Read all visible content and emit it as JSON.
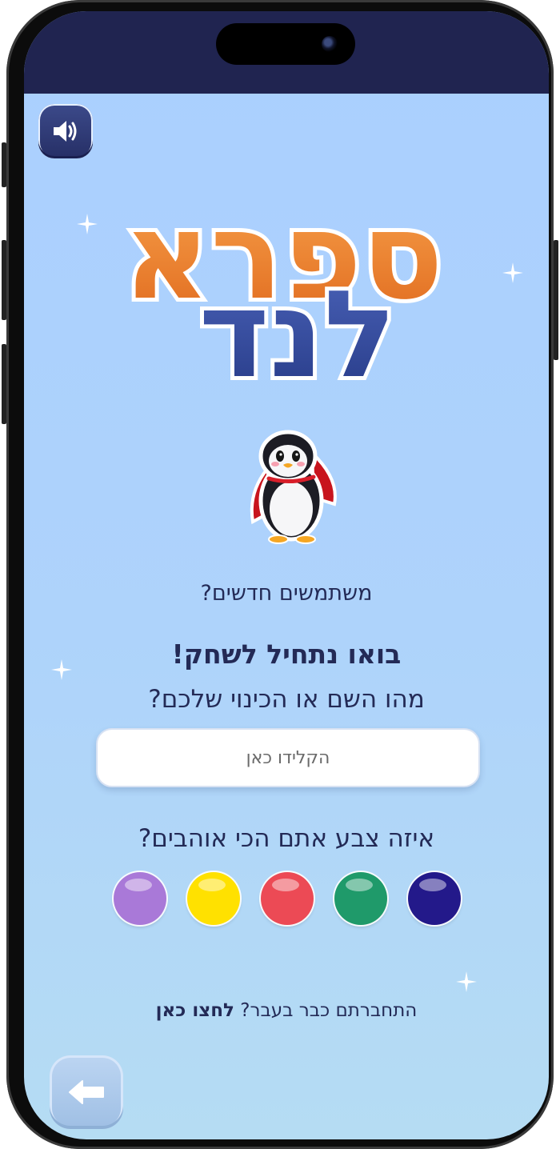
{
  "header": {
    "logo_text_line1": "ספרא",
    "logo_text_line2": "לנד"
  },
  "buttons": {
    "sound_icon": "speaker-icon",
    "back_icon": "arrow-left-icon"
  },
  "main": {
    "new_users_label": "משתמשים חדשים?",
    "start_title": "בואו נתחיל לשחק!",
    "name_question": "מהו השם או הכינוי שלכם?",
    "name_input": {
      "value": "",
      "placeholder": "הקלידו כאן"
    },
    "color_question": "איזה צבע אתם הכי אוהבים?",
    "colors": [
      {
        "name": "purple",
        "hex": "#a979d8"
      },
      {
        "name": "yellow",
        "hex": "#ffe100"
      },
      {
        "name": "red",
        "hex": "#ec4a55"
      },
      {
        "name": "green",
        "hex": "#1f9a6a"
      },
      {
        "name": "navy",
        "hex": "#23198a"
      }
    ],
    "login_prompt": "התחברתם כבר בעבר?",
    "login_link": "לחצו כאן"
  },
  "theme": {
    "background_top": "#aacfff",
    "background_bottom": "#b5dcf3",
    "text_color": "#232a56",
    "status_bar": "#202450"
  }
}
